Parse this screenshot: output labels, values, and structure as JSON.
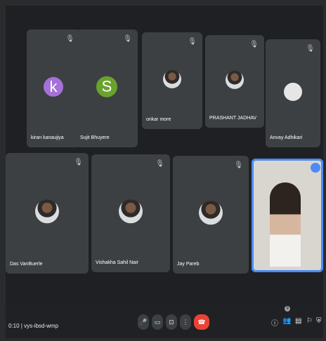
{
  "participants": [
    {
      "name": "kiran kanaujiya",
      "initial": "k",
      "color": "#a571d6"
    },
    {
      "name": "Sujit Bhuyere",
      "initial": "S",
      "color": "#69a22d"
    },
    {
      "name": "onkar more"
    },
    {
      "name": "PRASHANT JADHAV"
    },
    {
      "name": "Anvay Adhikari"
    },
    {
      "name": "Das VanBuerle"
    },
    {
      "name": "Vishakha Sahil Nair"
    },
    {
      "name": "Jay Pareb"
    }
  ],
  "mic_glyph": "🎙",
  "meeting": {
    "time": "0:10",
    "separator": "|",
    "code": "vys-ibsd-wmp"
  },
  "controls": {
    "mic": "🎤",
    "camera": "▭",
    "present": "⊡",
    "more": "⋮",
    "end_call": "☎"
  },
  "tools": {
    "info": "ⓘ",
    "people": "👥",
    "chat": "▤",
    "activities": "⚐",
    "host": "⛨"
  },
  "people_count": "9"
}
